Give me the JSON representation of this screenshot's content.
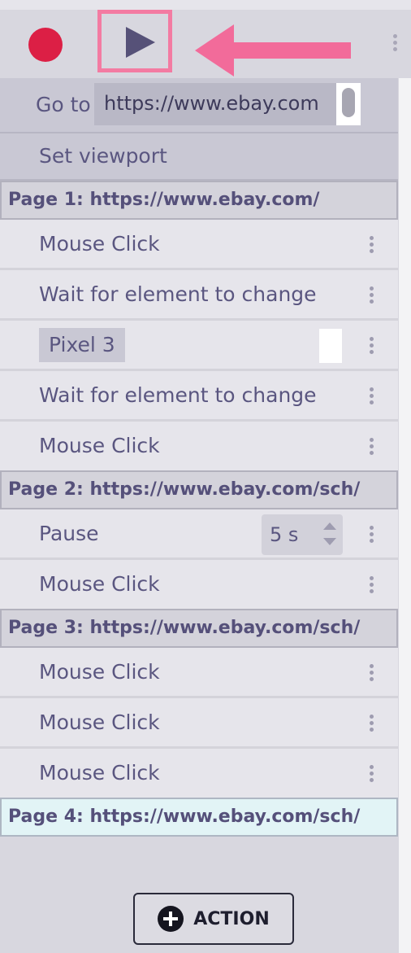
{
  "toolbar": {
    "record": "record-icon",
    "play": "play-icon",
    "arrow": "arrow-left-icon",
    "more": "kebab-icon"
  },
  "steps": {
    "goto_label": "Go to",
    "goto_url": "https://www.ebay.com",
    "viewport_label": "Set viewport",
    "page1": "Page 1: https://www.ebay.com/",
    "p1_click1": "Mouse Click",
    "p1_wait1": "Wait for element to change",
    "p1_pixel": "Pixel 3",
    "p1_wait2": "Wait for element to change",
    "p1_click2": "Mouse Click",
    "page2": "Page 2: https://www.ebay.com/sch/",
    "p2_pause": "Pause",
    "p2_pause_value": "5 s",
    "p2_click": "Mouse Click",
    "page3": "Page 3: https://www.ebay.com/sch/",
    "p3_click1": "Mouse Click",
    "p3_click2": "Mouse Click",
    "p3_click3": "Mouse Click",
    "page4": "Page 4: https://www.ebay.com/sch/"
  },
  "action_button": {
    "label": "ACTION"
  },
  "colors": {
    "record": "#dc1f45",
    "play": "#565178",
    "highlight_arrow": "#f26b9a",
    "text": "#5a5680"
  }
}
